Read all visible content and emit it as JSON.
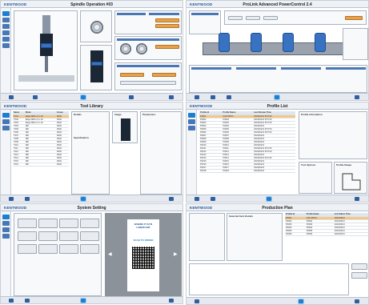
{
  "brand": "KENTWOOD",
  "panels": {
    "spindle": {
      "title": "Spindle Operation #03"
    },
    "powercontrol": {
      "title": "ProLink Advanced PowerControl 2.4"
    },
    "tools": {
      "title": "Tool Library",
      "columns": [
        "Name",
        "Mode",
        "Group"
      ],
      "rows": [
        [
          "T001",
          "Edge DRILL 8 x 40",
          "RAW"
        ],
        [
          "T002",
          "Edge DRILL 8 x 40",
          "RAW"
        ],
        [
          "T003",
          "Edge DRILL 8 x 40",
          "RAW"
        ],
        [
          "T004",
          "Mill",
          "RAW"
        ],
        [
          "T005",
          "Mill",
          "RAW"
        ],
        [
          "T006",
          "Mill",
          "RAW"
        ],
        [
          "T007",
          "Mill",
          "RAW"
        ],
        [
          "T008",
          "Mill",
          "RAW"
        ],
        [
          "T009",
          "Mill",
          "RAW"
        ],
        [
          "T010",
          "Mill",
          "RAW"
        ],
        [
          "T011",
          "Mill",
          "RAW"
        ],
        [
          "T012",
          "Mill",
          "RAW"
        ],
        [
          "T013",
          "Mill",
          "RAW"
        ],
        [
          "T014",
          "Mill",
          "RAW"
        ],
        [
          "T015",
          "Mill",
          "RAW"
        ],
        [
          "T016",
          "Mill",
          "RAW"
        ]
      ],
      "details_header": "Details",
      "spec_header": "Specification",
      "image_header": "Image",
      "params_header": "Parameters"
    },
    "profiles": {
      "title": "Profile List",
      "columns": [
        "Profile Id",
        "Profile Name",
        "Last Review Time"
      ],
      "rows": [
        [
          "P0001",
          "CAP-PRO1",
          "2023/03/21 8:57:00"
        ],
        [
          "P0002",
          "P0002",
          "2023/03/21 8:57:00"
        ],
        [
          "P0003",
          "P0003",
          "2023/03/21 8:57:00"
        ],
        [
          "P0004",
          "P0004",
          "2023/03/21"
        ],
        [
          "P0005",
          "P0005",
          "2023/03/21 8:57:00"
        ],
        [
          "P0006",
          "P0006",
          "2023/03/21 8:57:00"
        ],
        [
          "P0007",
          "P0007",
          "2023/03/21"
        ],
        [
          "P0008",
          "P0008",
          "2023/03/21"
        ],
        [
          "P0009",
          "P0009",
          "2023/03/21"
        ],
        [
          "P0010",
          "P0010",
          "2023/03/21"
        ],
        [
          "P0011",
          "P0011",
          "2023/03/21 8:57:00"
        ],
        [
          "P0012",
          "P0012",
          "2023/03/21 8:57:00"
        ],
        [
          "P0013",
          "P0013",
          "2023/03/21"
        ],
        [
          "P0014",
          "P0014",
          "2023/03/21 8:57:00"
        ],
        [
          "P0015",
          "P0015",
          "2023/03/21"
        ],
        [
          "P0016",
          "P0016",
          "2023/03/21"
        ],
        [
          "P0017",
          "P0017",
          "2023/03/21"
        ],
        [
          "P0018",
          "P0018",
          "2023/03/21"
        ]
      ],
      "info_header": "Profile Information",
      "tool_header": "Tool Options",
      "shape_header": "Profile Shape"
    },
    "system": {
      "title": "System Setting",
      "card_title": "WHERE IT ZA'N LUBRICANT",
      "card_cta": "SCAN TO ORDER"
    },
    "production": {
      "title": "Production Plan",
      "columns_left": [
        "Selected Item Details"
      ],
      "columns_right": [
        "Profile Id",
        "Profile Name",
        "Job Status Time"
      ],
      "rows": [
        [
          "P0001",
          "CAP-PRO1",
          "2023/03/21"
        ],
        [
          "P0002",
          "P0002",
          "2023/03/21"
        ],
        [
          "P0003",
          "P0003",
          "2023/03/21"
        ],
        [
          "P0004",
          "P0004",
          "2023/03/21"
        ],
        [
          "P0005",
          "P0005",
          "2023/03/21"
        ],
        [
          "P0006",
          "P0006",
          "2023/03/21"
        ]
      ]
    }
  },
  "colors": {
    "brand": "#1f4f92",
    "accent": "#1e7fd1",
    "highlight_row": "#f2c889",
    "orange_button": "#e8a24a"
  }
}
